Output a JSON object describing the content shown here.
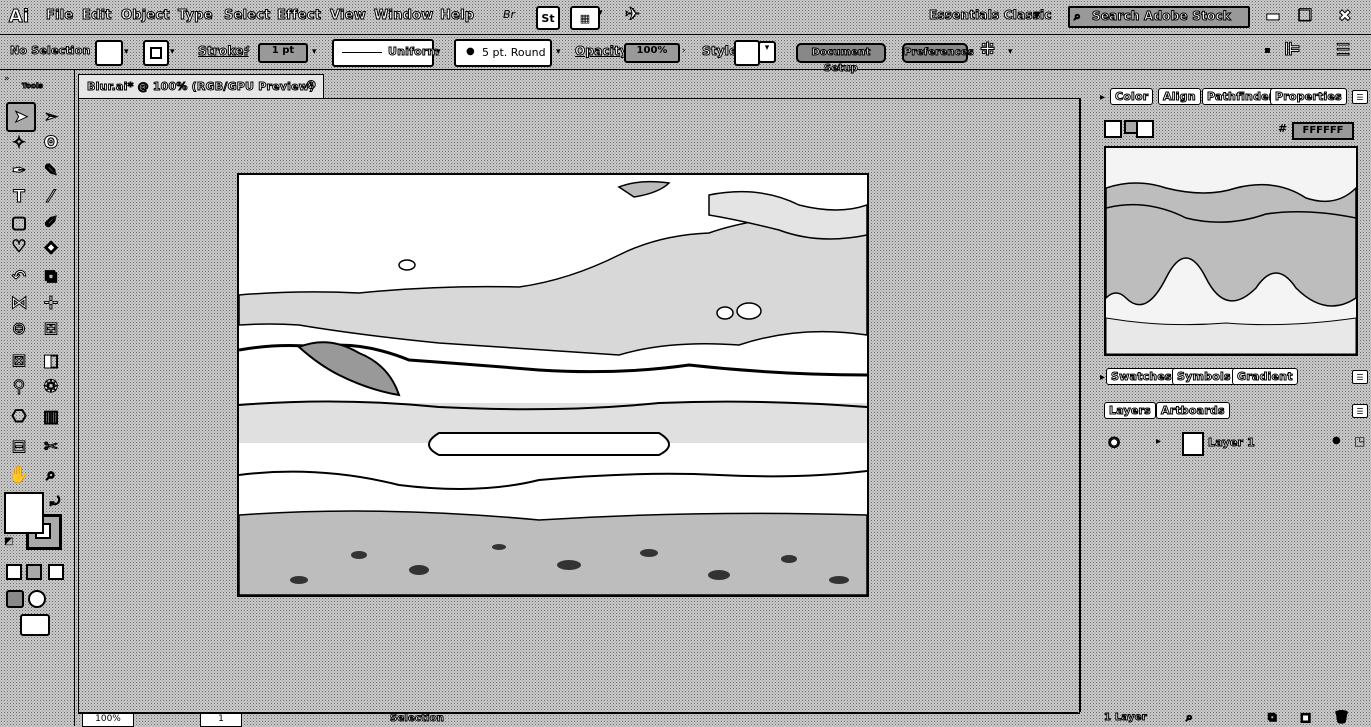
{
  "app": {
    "logo_text": "Ai"
  },
  "menu": {
    "items": [
      "File",
      "Edit",
      "Object",
      "Type",
      "Select",
      "Effect",
      "View",
      "Window",
      "Help"
    ],
    "bridge_label": "Br",
    "stock_label": "St",
    "workspace": "Essentials Classic",
    "search_placeholder": "Search Adobe Stock"
  },
  "control": {
    "selection_label": "No Selection",
    "stroke_label": "Stroke:",
    "stroke_weight": "1 pt",
    "profile": "Uniform",
    "brush": "5 pt. Round",
    "opacity_label": "Opacity:",
    "opacity_value": "100%",
    "style_label": "Style:",
    "document_setup": "Document Setup",
    "preferences": "Preferences"
  },
  "document": {
    "tab_title": "Blur.ai* @ 100% (RGB/GPU Preview)",
    "zoom": "100%",
    "page": "1",
    "status_tool": "Selection"
  },
  "panels": {
    "top_tabs": [
      "Color",
      "Align",
      "Pathfinder",
      "Properties"
    ],
    "hex_value": "FFFFFF",
    "middle_tabs": [
      "Swatches",
      "Symbols",
      "Gradient"
    ],
    "bottom_tabs": [
      "Layers",
      "Artboards"
    ],
    "layer_name": "Layer 1",
    "footer_label": "1 Layer"
  },
  "toolbar": {
    "panel_label": "Tools"
  }
}
